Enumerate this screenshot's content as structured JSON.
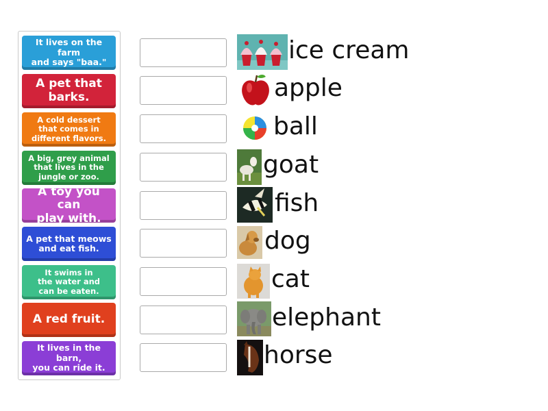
{
  "cards": [
    {
      "text": "It lives on the farm\nand says \"baa.\"",
      "color": "#2a9fd8"
    },
    {
      "text": "A pet that\nbarks.",
      "color": "#d2233a"
    },
    {
      "text": "A cold dessert\nthat comes in\ndifferent flavors.",
      "color": "#f07a12"
    },
    {
      "text": "A big, grey animal\nthat lives in the\njungle or zoo.",
      "color": "#2f9e4a"
    },
    {
      "text": "A toy you can\nplay with.",
      "color": "#c352c7"
    },
    {
      "text": "A pet that meows\nand eat fish.",
      "color": "#2e4ed6"
    },
    {
      "text": "It swims in\nthe water and\ncan be eaten.",
      "color": "#3dbf8a"
    },
    {
      "text": "A red fruit.",
      "color": "#e0401e"
    },
    {
      "text": "It lives in the barn,\nyou can ride it.",
      "color": "#8b3ed6"
    }
  ],
  "items": [
    {
      "word": "ice cream",
      "icon": "cupcakes-icon"
    },
    {
      "word": "apple",
      "icon": "apple-icon"
    },
    {
      "word": "ball",
      "icon": "beach-ball-icon"
    },
    {
      "word": "goat",
      "icon": "goat-icon"
    },
    {
      "word": "fish",
      "icon": "fish-icon"
    },
    {
      "word": "dog",
      "icon": "dog-icon"
    },
    {
      "word": "cat",
      "icon": "cat-icon"
    },
    {
      "word": "elephant",
      "icon": "elephant-icon"
    },
    {
      "word": "horse",
      "icon": "horse-icon"
    }
  ]
}
